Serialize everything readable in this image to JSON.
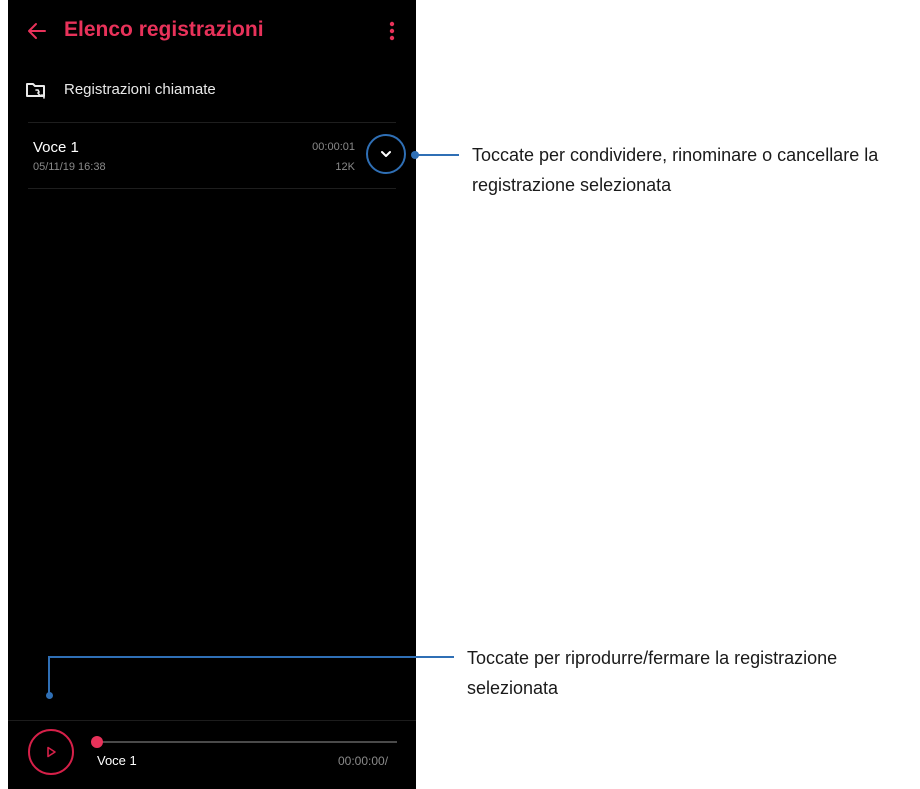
{
  "app_bar": {
    "title": "Elenco registrazioni",
    "back_icon": "arrow-left-icon",
    "more_icon": "more-vertical-icon",
    "accent_color": "#e8325a"
  },
  "folder": {
    "icon": "call-folder-icon",
    "label": "Registrazioni chiamate"
  },
  "recordings": [
    {
      "name": "Voce 1",
      "date": "05/11/19 16:38",
      "duration": "00:00:01",
      "size": "12K",
      "expand_icon": "chevron-down-icon"
    }
  ],
  "player": {
    "play_icon": "play-icon",
    "title": "Voce 1",
    "time": "00:00:00/",
    "progress": 0
  },
  "callouts": {
    "expand": {
      "line1": "Toccate per condividere, rinominare o cancellare la",
      "line2": "registrazione selezionata"
    },
    "play": {
      "line1": "Toccate per riprodurre/fermare la registrazione",
      "line2": "selezionata"
    },
    "color": "#2f6fb5"
  }
}
